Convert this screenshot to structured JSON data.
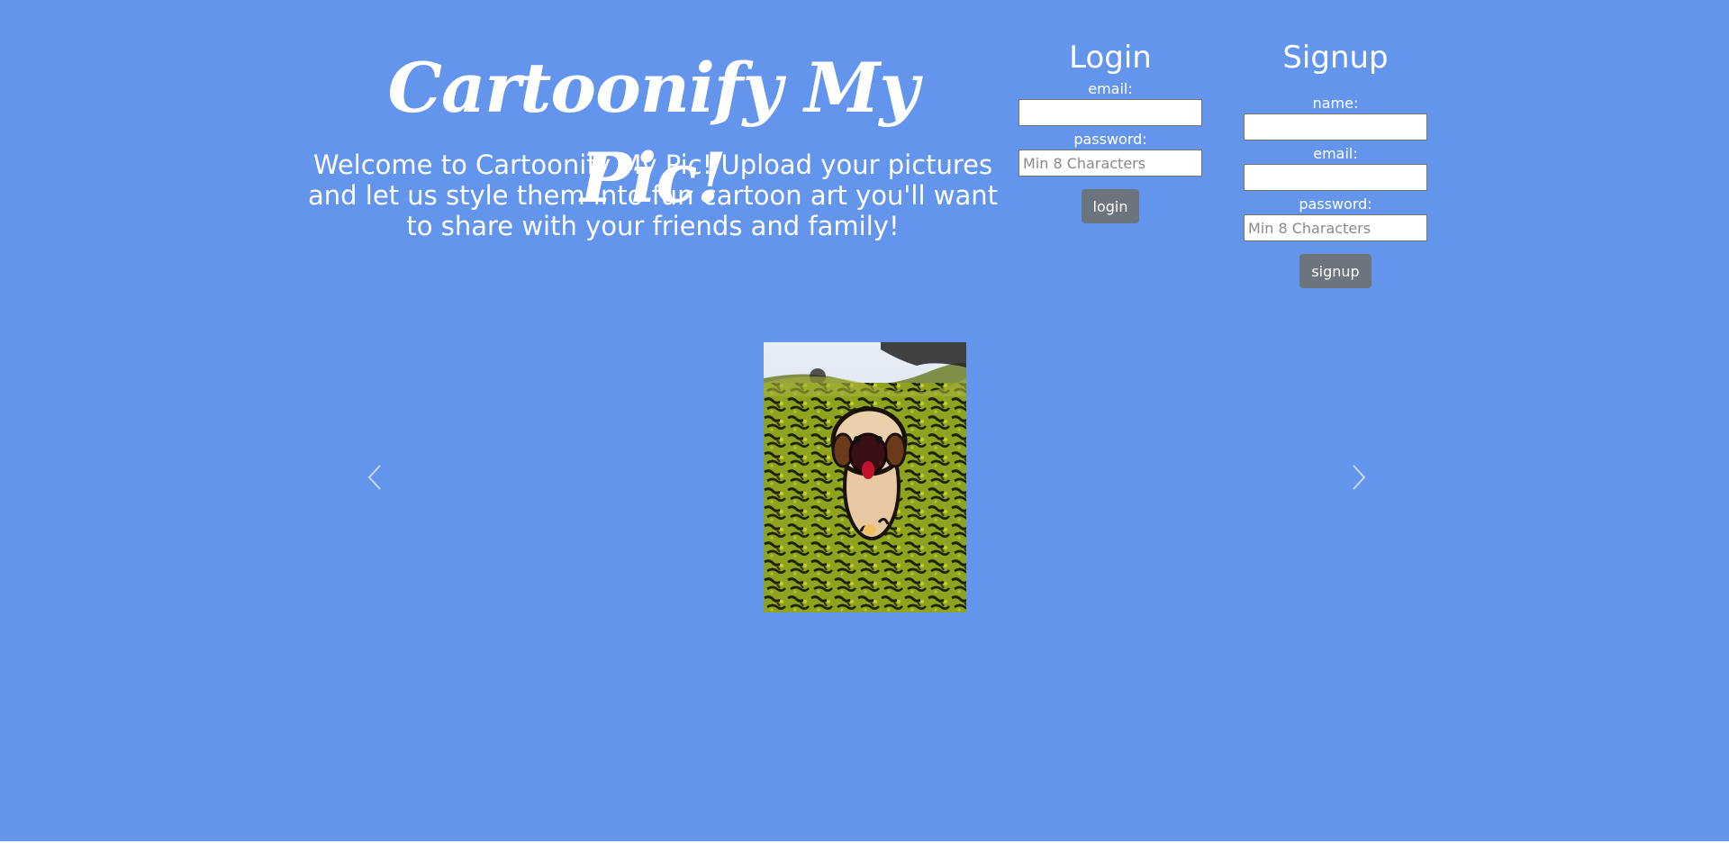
{
  "header": {
    "title": "Cartoonify My Pic!",
    "welcome": "Welcome to Cartoonify My Pic! Upload your pictures and let us style them into fun cartoon art you'll want to share with your friends and family!"
  },
  "login": {
    "heading": "Login",
    "email_label": "email:",
    "email_value": "",
    "password_label": "password:",
    "password_placeholder": "Min 8 Characters",
    "button_label": "login"
  },
  "signup": {
    "heading": "Signup",
    "name_label": "name:",
    "name_value": "",
    "email_label": "email:",
    "email_value": "",
    "password_label": "password:",
    "password_placeholder": "Min 8 Characters",
    "button_label": "signup"
  },
  "carousel": {
    "prev_icon": "chevron-left-icon",
    "next_icon": "chevron-right-icon"
  },
  "colors": {
    "background": "#6495ed",
    "button": "#6c757d",
    "text": "#ffffff"
  }
}
